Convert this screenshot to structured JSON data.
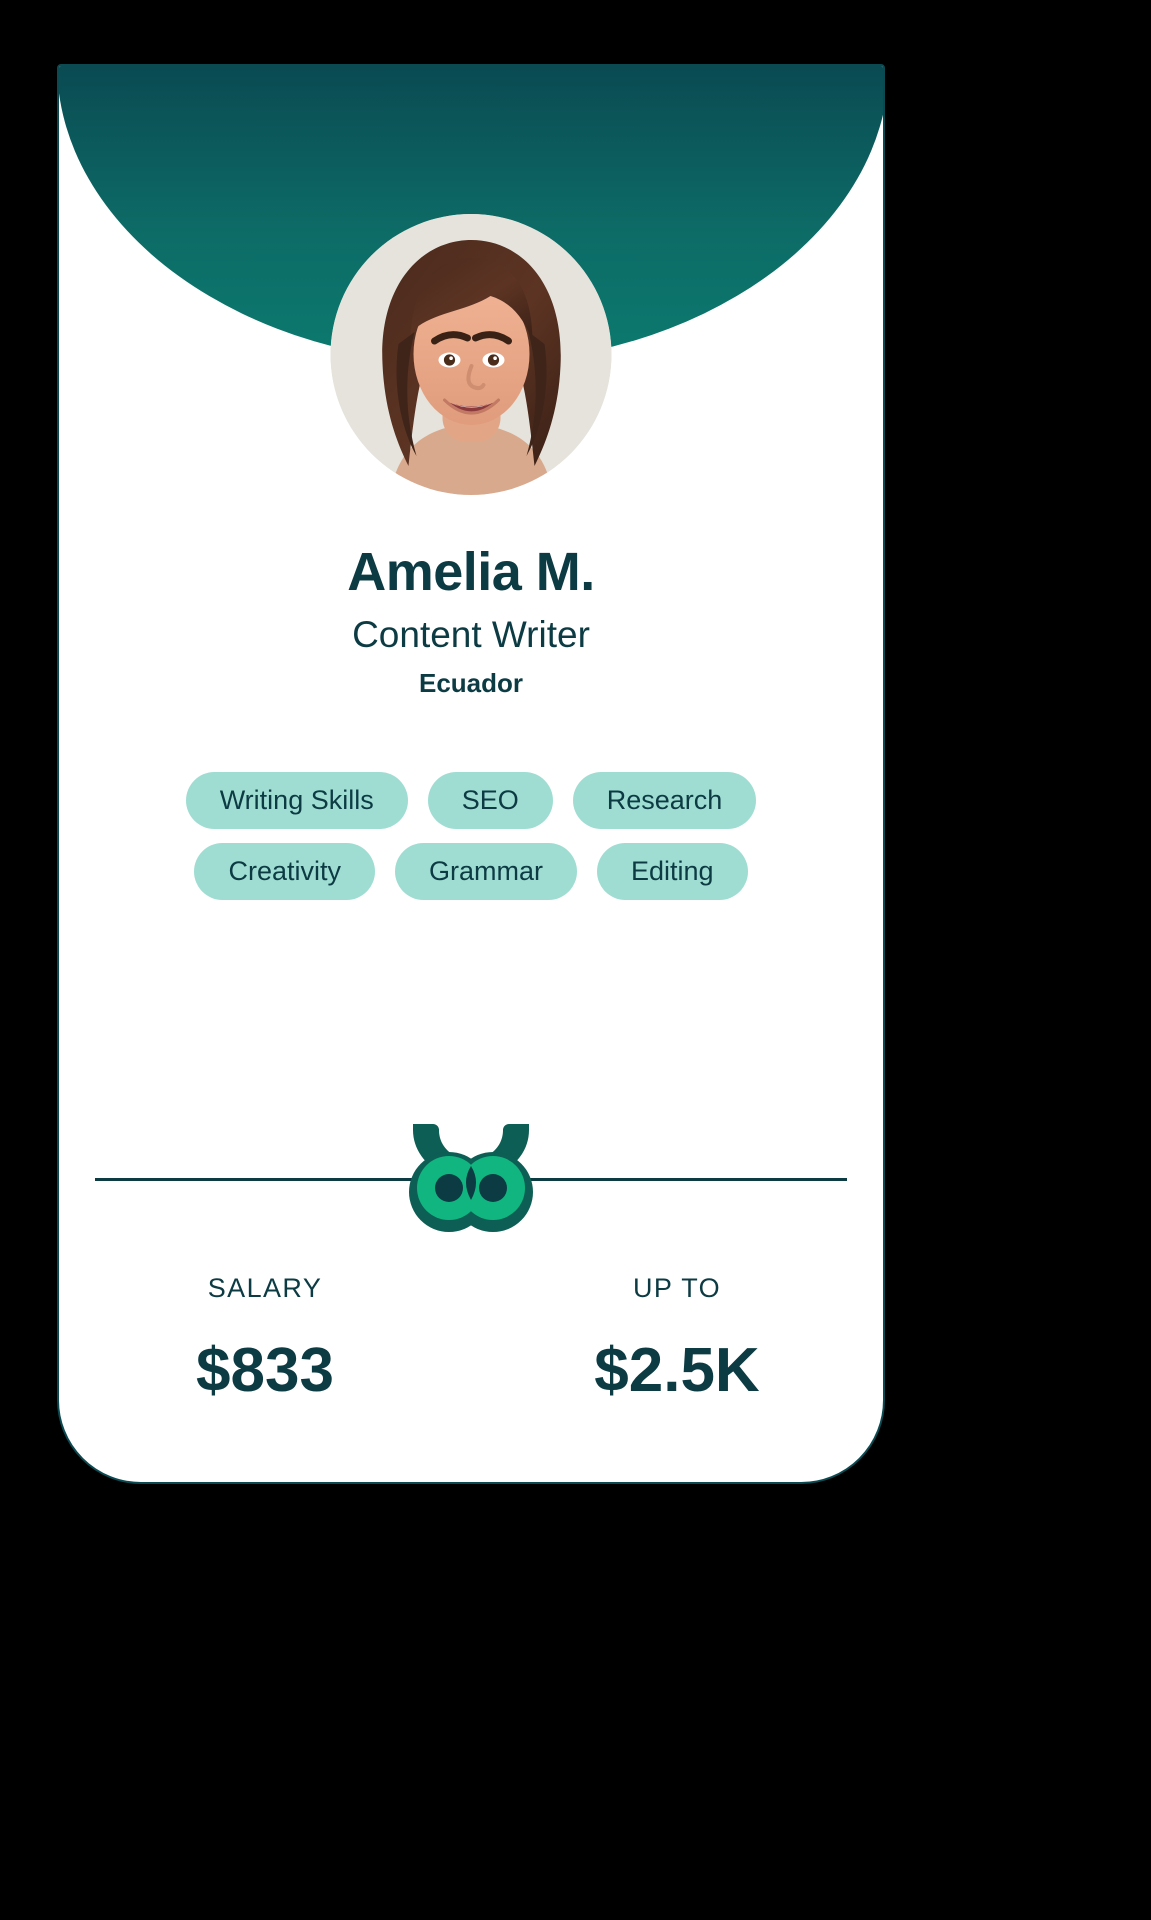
{
  "card": {
    "background_color": "#ffffff",
    "border_color": "#0c4a52",
    "header_color": "#0a4a52",
    "accent_color": "#0c3b44",
    "tag_color": "#9fddd2",
    "logo_green": "#10b981"
  },
  "profile": {
    "avatar_alt": "avatar-photo",
    "name": "Amelia M.",
    "role": "Content Writer",
    "country": "Ecuador"
  },
  "skills": [
    {
      "label": "Writing Skills"
    },
    {
      "label": "SEO"
    },
    {
      "label": "Research"
    },
    {
      "label": "Creativity"
    },
    {
      "label": "Grammar"
    },
    {
      "label": "Editing"
    }
  ],
  "brand": {
    "logo_name": "owl-logo"
  },
  "salary": {
    "left": {
      "label": "SALARY",
      "value": "$833"
    },
    "right": {
      "label": "UP TO",
      "value": "$2.5K"
    }
  }
}
